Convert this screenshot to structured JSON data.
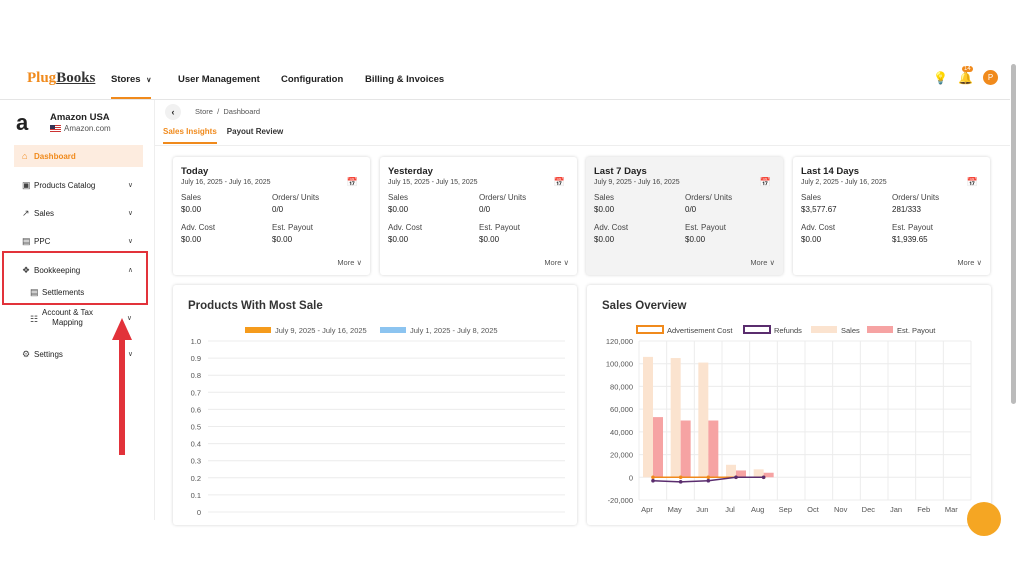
{
  "brand": {
    "part1": "Plug",
    "part2": "Books"
  },
  "topnav": {
    "items": [
      "Stores",
      "User Management",
      "Configuration",
      "Billing & Invoices"
    ],
    "notification_count": "14",
    "avatar_initial": "P"
  },
  "store": {
    "name": "Amazon USA",
    "domain": "Amazon.com",
    "logo_letter": "a"
  },
  "sidebar": {
    "items": [
      {
        "label": "Dashboard",
        "icon": "home-icon"
      },
      {
        "label": "Products Catalog",
        "icon": "box-icon"
      },
      {
        "label": "Sales",
        "icon": "chart-line-icon"
      },
      {
        "label": "PPC",
        "icon": "ad-icon"
      },
      {
        "label": "Bookkeeping",
        "icon": "ledger-icon"
      },
      {
        "label": "Settlements",
        "icon": "document-icon"
      },
      {
        "label": "Account & Tax",
        "label2": "Mapping",
        "icon": "hierarchy-icon"
      },
      {
        "label": "Settings",
        "icon": "gear-icon"
      }
    ]
  },
  "breadcrumb": {
    "store": "Store",
    "sep": "/",
    "page": "Dashboard"
  },
  "tabs": [
    "Sales Insights",
    "Payout Review"
  ],
  "cards": [
    {
      "title": "Today",
      "range": "July 16, 2025 - July 16, 2025",
      "sales_label": "Sales",
      "sales": "$0.00",
      "orders_label": "Orders/ Units",
      "orders": "0/0",
      "adv_label": "Adv. Cost",
      "adv": "$0.00",
      "payout_label": "Est. Payout",
      "payout": "$0.00",
      "more": "More"
    },
    {
      "title": "Yesterday",
      "range": "July 15, 2025 - July 15, 2025",
      "sales_label": "Sales",
      "sales": "$0.00",
      "orders_label": "Orders/ Units",
      "orders": "0/0",
      "adv_label": "Adv. Cost",
      "adv": "$0.00",
      "payout_label": "Est. Payout",
      "payout": "$0.00",
      "more": "More"
    },
    {
      "title": "Last 7 Days",
      "range": "July 9, 2025 - July 16, 2025",
      "sales_label": "Sales",
      "sales": "$0.00",
      "orders_label": "Orders/ Units",
      "orders": "0/0",
      "adv_label": "Adv. Cost",
      "adv": "$0.00",
      "payout_label": "Est. Payout",
      "payout": "$0.00",
      "more": "More"
    },
    {
      "title": "Last 14 Days",
      "range": "July 2, 2025 - July 16, 2025",
      "sales_label": "Sales",
      "sales": "$3,577.67",
      "orders_label": "Orders/ Units",
      "orders": "281/333",
      "adv_label": "Adv. Cost",
      "adv": "$0.00",
      "payout_label": "Est. Payout",
      "payout": "$1,939.65",
      "more": "More"
    }
  ],
  "colors": {
    "accent": "#f08a1c",
    "highlight": "#e2323a"
  },
  "chart_data": [
    {
      "type": "bar",
      "title": "Products With Most Sale",
      "series": [
        {
          "name": "July 9, 2025 - July 16, 2025",
          "color": "#f59b1c",
          "values": []
        },
        {
          "name": "July 1, 2025 - July 8, 2025",
          "color": "#8cc4f0",
          "values": []
        }
      ],
      "ylim": [
        0,
        1.0
      ],
      "yticks": [
        "1.0",
        "0.9",
        "0.8",
        "0.7",
        "0.6",
        "0.5",
        "0.4",
        "0.3",
        "0.2",
        "0.1",
        "0"
      ],
      "legend": "top-center",
      "grid": true
    },
    {
      "type": "bar",
      "title": "Sales Overview",
      "categories": [
        "Apr",
        "May",
        "Jun",
        "Jul",
        "Aug",
        "Sep",
        "Oct",
        "Nov",
        "Dec",
        "Jan",
        "Feb",
        "Mar"
      ],
      "series": [
        {
          "name": "Advertisement Cost",
          "type": "line",
          "color": "#f08a1c",
          "values": [
            0,
            0,
            0,
            0,
            0,
            null,
            null,
            null,
            null,
            null,
            null,
            null
          ]
        },
        {
          "name": "Refunds",
          "type": "line",
          "color": "#5a2d6e",
          "values": [
            -3000,
            -4000,
            -3000,
            0,
            0,
            null,
            null,
            null,
            null,
            null,
            null,
            null
          ]
        },
        {
          "name": "Sales",
          "type": "bar",
          "color": "#fbe3cf",
          "values": [
            106000,
            105000,
            101000,
            11000,
            7000,
            0,
            0,
            0,
            0,
            0,
            0,
            0
          ]
        },
        {
          "name": "Est. Payout",
          "type": "bar",
          "color": "#f6a3a3",
          "values": [
            53000,
            50000,
            50000,
            6000,
            4000,
            0,
            0,
            0,
            0,
            0,
            0,
            0
          ]
        }
      ],
      "yticks": [
        "120,000",
        "100,000",
        "80,000",
        "60,000",
        "40,000",
        "20,000",
        "0",
        "-20,000"
      ],
      "ylim": [
        -20000,
        120000
      ],
      "legend": "top-center",
      "grid": true
    }
  ]
}
